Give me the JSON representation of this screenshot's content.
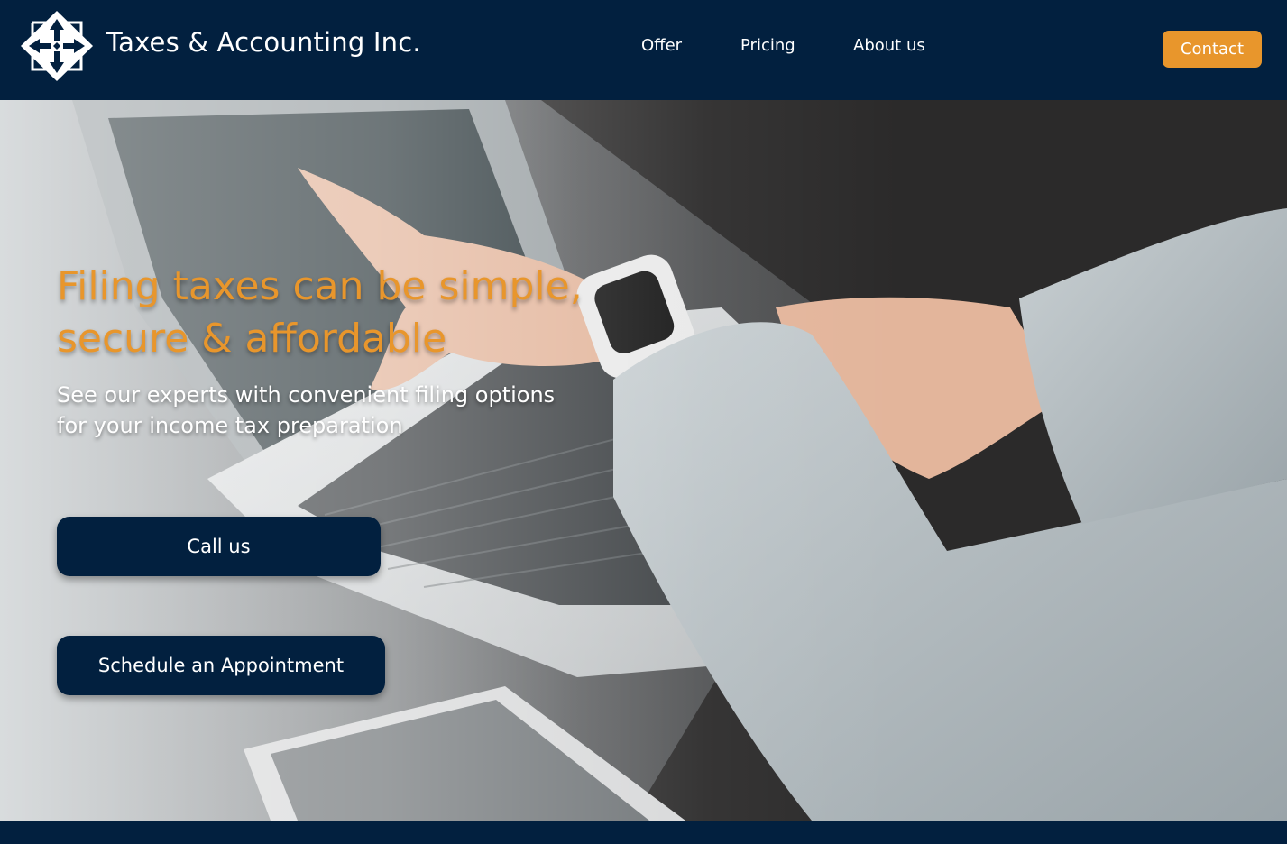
{
  "header": {
    "brand": "Taxes & Accounting Inc.",
    "logo_icon": "diamond-arrows-logo-icon",
    "nav": [
      {
        "label": "Offer"
      },
      {
        "label": "Pricing"
      },
      {
        "label": "About us"
      }
    ],
    "contact_label": "Contact"
  },
  "hero": {
    "headline_line1": "Filing taxes can be simple,",
    "headline_line2": "secure & affordable",
    "sub_line1": "See our experts with convenient filing options",
    "sub_line2": "for your income tax preparation",
    "call_label": "Call us",
    "schedule_label": "Schedule an Appointment",
    "background_image": "person-using-laptop-with-smartwatch"
  },
  "colors": {
    "navy": "#02203f",
    "accent_orange": "#e8962c",
    "white": "#ffffff"
  }
}
